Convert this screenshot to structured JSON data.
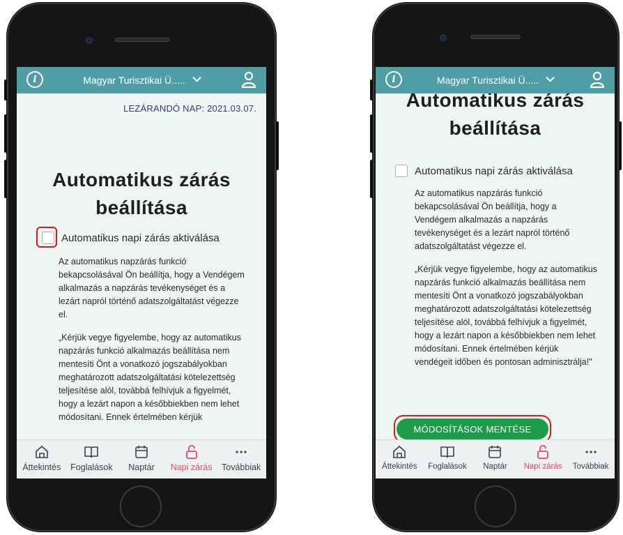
{
  "app": {
    "org_name": "Magyar Turisztikai Ü.....",
    "accent_color": "#4f9ea5",
    "active_color": "#e8475f",
    "save_color": "#1d9a4a",
    "highlight_color": "#d81a1a"
  },
  "left_screen": {
    "date_label": "LEZÁRANDÓ NAP: 2021.03.07.",
    "title_line1": "Automatikus zárás",
    "title_line2": "beállítása",
    "checkbox_label": "Automatikus napi zárás aktiválása",
    "para1": "Az automatikus napzárás funkció bekapcsolásával Ön beállítja, hogy a Vendégem alkalmazás a napzárás tevékenységet és a lezárt napról történő adatszolgáltatást végezze el.",
    "para2": "„Kérjük vegye figyelembe, hogy az automatikus napzárás funkció alkalmazás beállítása nem mentesíti Önt a vonatkozó jogszabályokban meghatározott adatszolgáltatási kötelezettség teljesítése alól, továbbá felhívjuk a figyelmét, hogy a lezárt napon a későbbiekben nem lehet módosítani. Ennek értelmében kérjük"
  },
  "right_screen": {
    "title_line1": "Automatikus zárás",
    "title_line2": "beállítása",
    "checkbox_label": "Automatikus napi zárás aktiválása",
    "para1": "Az automatikus napzárás funkció bekapcsolásával Ön beállítja, hogy a Vendégem alkalmazás a napzárás tevékenységet és a lezárt napról történő adatszolgáltatást végezze el.",
    "para2": "„Kérjük vegye figyelembe, hogy az automatikus napzárás funkció alkalmazás beállítása nem mentesíti Önt a vonatkozó jogszabályokban meghatározott adatszolgáltatási kötelezettség teljesítése alól, továbbá felhívjuk a figyelmét, hogy a lezárt napon a későbbiekben nem lehet módosítani. Ennek értelmében kérjük vendégeit időben és pontosan adminisztrálja!\"",
    "save_button": "MÓDOSÍTÁSOK MENTÉSE"
  },
  "tabs": [
    {
      "label": "Áttekintés",
      "icon": "home-icon"
    },
    {
      "label": "Foglalások",
      "icon": "book-icon"
    },
    {
      "label": "Naptár",
      "icon": "calendar-icon"
    },
    {
      "label": "Napi zárás",
      "icon": "unlock-icon",
      "active": true
    },
    {
      "label": "Továbbiak",
      "icon": "more-icon"
    }
  ]
}
